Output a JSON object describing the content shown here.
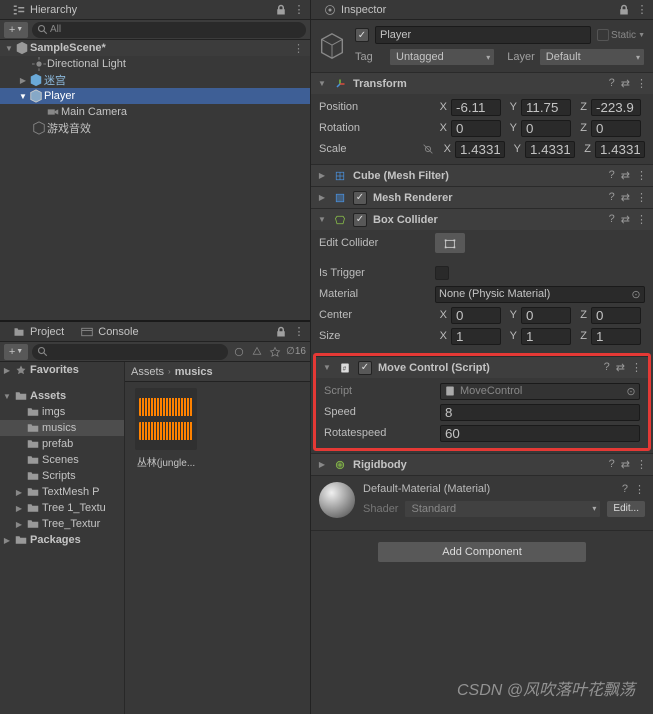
{
  "watermark": "CSDN @风吹落叶花飘荡",
  "hierarchy": {
    "title": "Hierarchy",
    "search_placeholder": "All",
    "scene": "SampleScene*",
    "items": [
      "Directional Light",
      "迷宫",
      "Player",
      "Main Camera",
      "游戏音效"
    ]
  },
  "project": {
    "tab1": "Project",
    "tab2": "Console",
    "hidden_count": "16",
    "favorites": "Favorites",
    "packages": "Packages",
    "assets_label": "Assets",
    "folders": [
      "imgs",
      "musics",
      "prefab",
      "Scenes",
      "Scripts",
      "TextMesh P",
      "Tree 1_Textu",
      "Tree_Textur"
    ],
    "selected_folder_index": 1,
    "breadcrumb": [
      "Assets",
      "musics"
    ],
    "asset_name": "丛林(jungle..."
  },
  "inspector": {
    "title": "Inspector",
    "go_name": "Player",
    "static_label": "Static",
    "tag_label": "Tag",
    "tag_value": "Untagged",
    "layer_label": "Layer",
    "layer_value": "Default",
    "transform": {
      "title": "Transform",
      "position_label": "Position",
      "rotation_label": "Rotation",
      "scale_label": "Scale",
      "pos": {
        "x": "-6.11",
        "y": "11.75",
        "z": "-223.9"
      },
      "rot": {
        "x": "0",
        "y": "0",
        "z": "0"
      },
      "scale": {
        "x": "1.4331",
        "y": "1.4331",
        "z": "1.4331"
      }
    },
    "mesh_filter": {
      "title": "Cube (Mesh Filter)"
    },
    "mesh_renderer": {
      "title": "Mesh Renderer"
    },
    "box_collider": {
      "title": "Box Collider",
      "edit_label": "Edit Collider",
      "is_trigger_label": "Is Trigger",
      "material_label": "Material",
      "material_value": "None (Physic Material)",
      "center_label": "Center",
      "center": {
        "x": "0",
        "y": "0",
        "z": "0"
      },
      "size_label": "Size",
      "size": {
        "x": "1",
        "y": "1",
        "z": "1"
      }
    },
    "move_control": {
      "title": "Move Control (Script)",
      "script_label": "Script",
      "script_value": "MoveControl",
      "speed_label": "Speed",
      "speed_value": "8",
      "rotate_label": "Rotatespeed",
      "rotate_value": "60"
    },
    "rigidbody": {
      "title": "Rigidbody"
    },
    "material": {
      "title": "Default-Material (Material)",
      "shader_label": "Shader",
      "shader_value": "Standard",
      "edit_label": "Edit..."
    },
    "add_component": "Add Component"
  }
}
